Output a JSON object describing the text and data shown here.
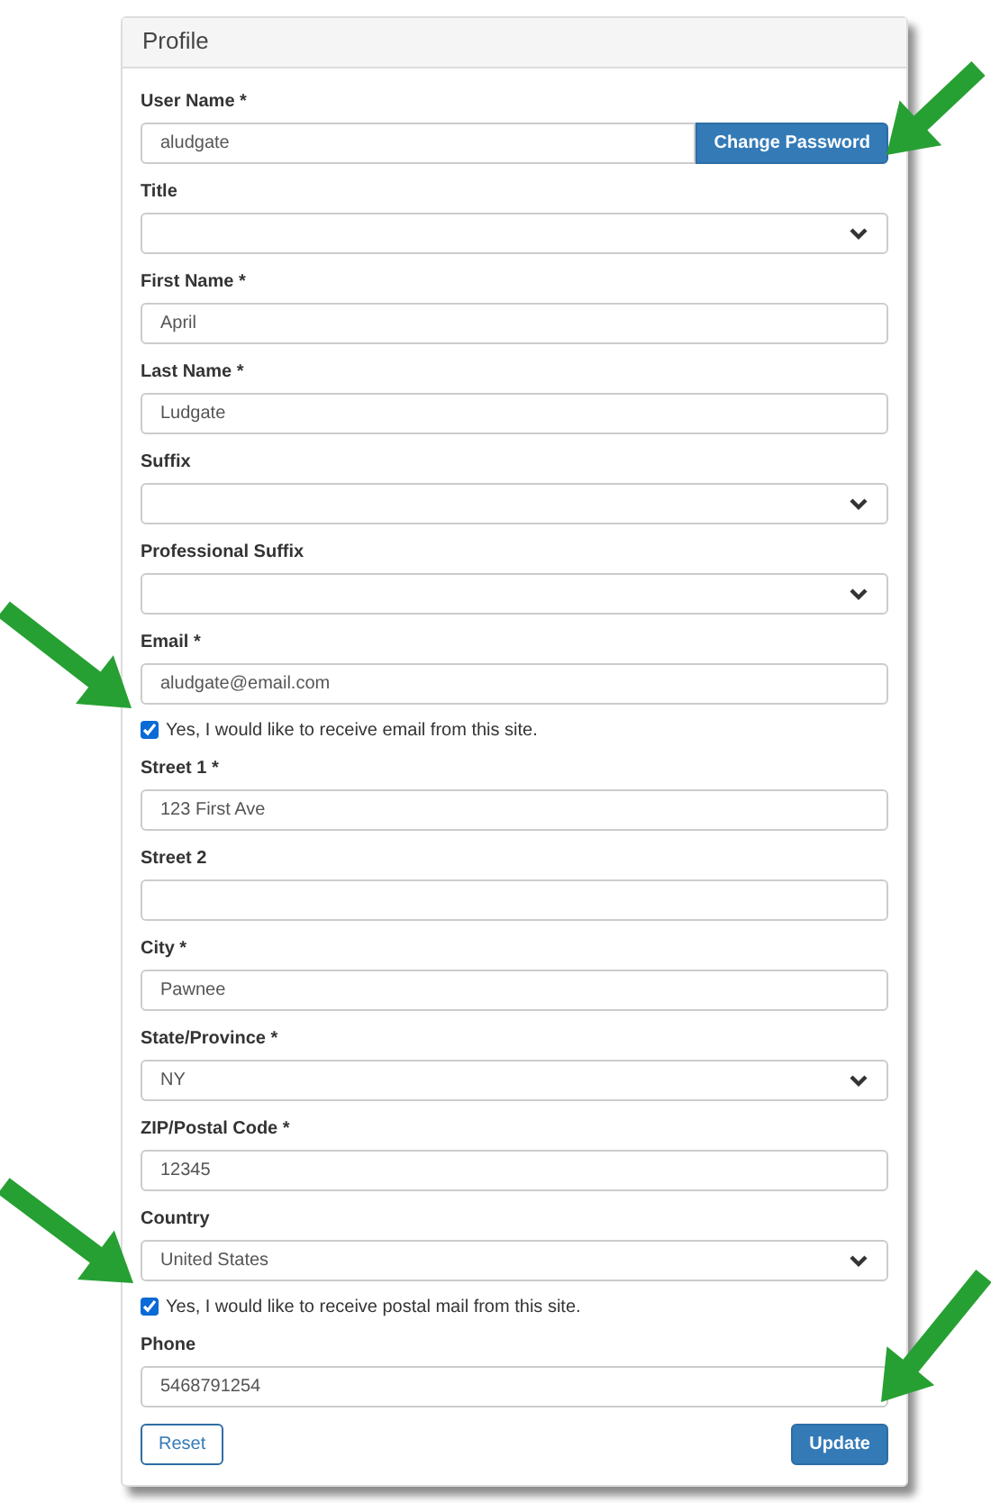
{
  "panel": {
    "title": "Profile"
  },
  "fields": [
    {
      "kind": "text",
      "label": "User Name *",
      "value": "aludgate",
      "button": "Change Password"
    },
    {
      "kind": "select",
      "label": "Title"
    },
    {
      "kind": "text",
      "label": "First Name *",
      "value": "April"
    },
    {
      "kind": "text",
      "label": "Last Name *",
      "value": "Ludgate"
    },
    {
      "kind": "select",
      "label": "Suffix"
    },
    {
      "kind": "select",
      "label": "Professional Suffix"
    },
    {
      "kind": "text",
      "label": "Email *",
      "value": "aludgate@email.com"
    },
    {
      "kind": "checkbox",
      "label": "Yes, I would like to receive email from this site.",
      "checked": true
    },
    {
      "kind": "text",
      "label": "Street 1 *",
      "value": "123 First Ave"
    },
    {
      "kind": "text",
      "label": "Street 2"
    },
    {
      "kind": "text",
      "label": "City *",
      "value": "Pawnee"
    },
    {
      "kind": "select",
      "label": "State/Province *",
      "value": "NY"
    },
    {
      "kind": "text",
      "label": "ZIP/Postal Code *",
      "value": "12345"
    },
    {
      "kind": "select",
      "label": "Country",
      "value": "United States"
    },
    {
      "kind": "checkbox",
      "label": "Yes, I would like to receive postal mail from this site.",
      "checked": true
    },
    {
      "kind": "text",
      "label": "Phone",
      "value": "5468791254"
    }
  ],
  "buttons": {
    "reset": "Reset",
    "submit": "Update"
  }
}
